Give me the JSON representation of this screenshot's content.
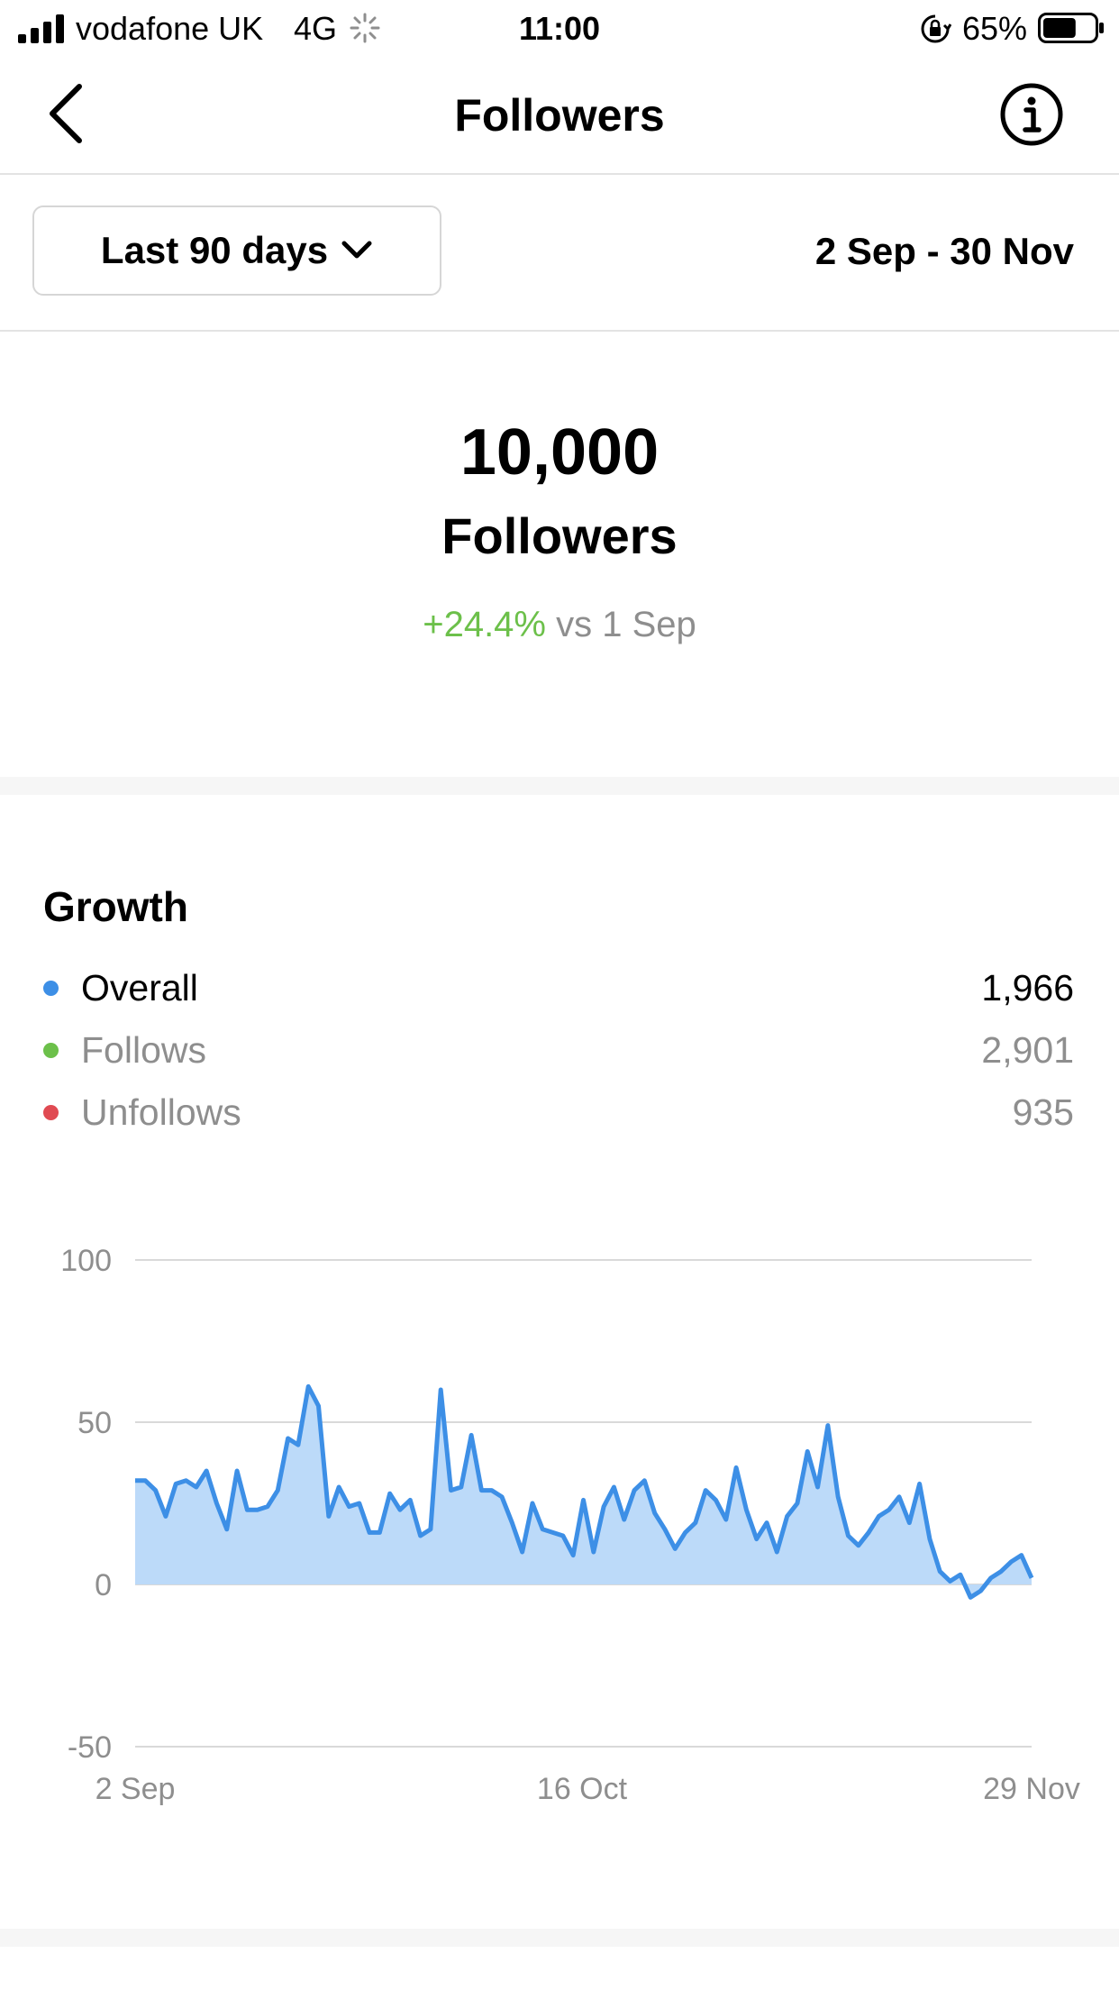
{
  "status_bar": {
    "carrier": "vodafone UK",
    "network": "4G",
    "time": "11:00",
    "battery_percent": "65%",
    "battery_level": 0.65,
    "icons": [
      "signal-icon",
      "activity-icon",
      "lock-rotation-icon",
      "battery-icon"
    ]
  },
  "nav": {
    "title": "Followers",
    "back_icon": "chevron-left-icon",
    "info_icon": "info-icon"
  },
  "date_filter": {
    "selected": "Last 90 days",
    "range": "2 Sep - 30 Nov"
  },
  "summary": {
    "count": "10,000",
    "label": "Followers",
    "change_pct": "+24.4%",
    "change_ref": "vs 1 Sep"
  },
  "growth": {
    "title": "Growth",
    "legend": [
      {
        "label": "Overall",
        "value": "1,966",
        "color": "#3d8fe6",
        "muted": false
      },
      {
        "label": "Follows",
        "value": "2,901",
        "color": "#6cc04a",
        "muted": true
      },
      {
        "label": "Unfollows",
        "value": "935",
        "color": "#e04a52",
        "muted": true
      }
    ]
  },
  "colors": {
    "accent_blue": "#3d8fe6",
    "area_fill": "#bcdaf9",
    "positive_green": "#6cc04a",
    "muted_text": "#8e8e8e",
    "gridline": "#d9d9d9"
  },
  "chart_data": {
    "type": "area",
    "series": [
      {
        "values": [
          32,
          32,
          29,
          21,
          31,
          32,
          30,
          35,
          25,
          17,
          35,
          23,
          23,
          24,
          29,
          45,
          43,
          61,
          55,
          21,
          30,
          24,
          25,
          16,
          16,
          28,
          23,
          26,
          15,
          17,
          60,
          29,
          30,
          46,
          29,
          29,
          27,
          19,
          10,
          25,
          17,
          16,
          15,
          9,
          26,
          10,
          24,
          30,
          20,
          29,
          32,
          22,
          17,
          11,
          16,
          19,
          29,
          26,
          20,
          36,
          23,
          14,
          19,
          10,
          21,
          25,
          41,
          30,
          49,
          27,
          15,
          12,
          16,
          21,
          23,
          27,
          19,
          31,
          14,
          4,
          1,
          3,
          -4,
          -2,
          2,
          4,
          7,
          9,
          2
        ]
      }
    ],
    "x_tick_labels": [
      "2 Sep",
      "16 Oct",
      "29 Nov"
    ],
    "y_tick_labels": [
      "100",
      "50",
      "0",
      "-50"
    ],
    "ylim": [
      -50,
      100
    ],
    "grid": true,
    "legend": "none"
  }
}
